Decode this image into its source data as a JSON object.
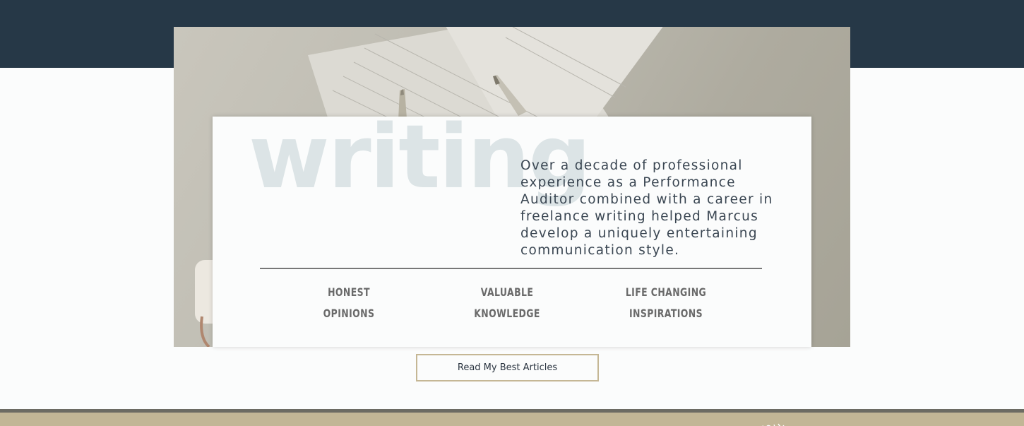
{
  "hero": {
    "background_word": "writing",
    "intro_text": "Over a decade of professional experience as a Performance Auditor combined with a career in freelance writing helped Marcus develop a uniquely entertaining communication style."
  },
  "pillars": [
    {
      "line1": "HONEST",
      "line2": "OPINIONS"
    },
    {
      "line1": "VALUABLE",
      "line2": "KNOWLEDGE"
    },
    {
      "line1": "LIFE CHANGING",
      "line2": "INSPIRATIONS"
    }
  ],
  "cta": {
    "label": "Read My Best Articles"
  },
  "colors": {
    "header_band": "#263847",
    "accent_border": "#c5b795",
    "footer": "#c2b696",
    "watermark_text": "#dce4e6"
  },
  "icons": {
    "footer_mark": "signature-logo"
  }
}
